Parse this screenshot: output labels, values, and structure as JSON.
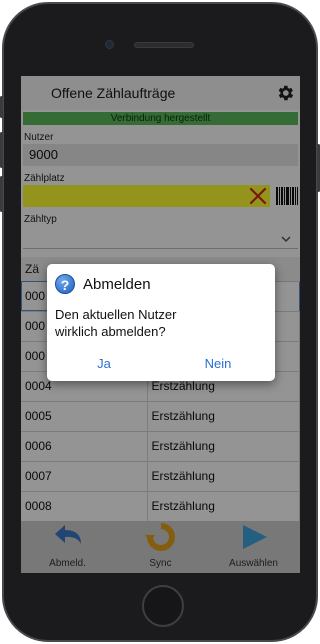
{
  "header": {
    "title": "Offene Zählaufträge",
    "settings_icon": "gear-icon"
  },
  "status": {
    "connection": "Verbindung hergestellt",
    "color": "#5cb85c"
  },
  "form": {
    "user_label": "Nutzer",
    "user_value": "9000",
    "zaehlplatz_label": "Zählplatz",
    "zaehlplatz_value": "",
    "zaehltyp_label": "Zähltyp",
    "zaehltyp_value": ""
  },
  "table": {
    "headers": [
      "Zä",
      ""
    ],
    "rows": [
      {
        "id": "000",
        "type": ""
      },
      {
        "id": "000",
        "type": ""
      },
      {
        "id": "000",
        "type": ""
      },
      {
        "id": "0004",
        "type": "Erstzählung"
      },
      {
        "id": "0005",
        "type": "Erstzählung"
      },
      {
        "id": "0006",
        "type": "Erstzählung"
      },
      {
        "id": "0007",
        "type": "Erstzählung"
      },
      {
        "id": "0008",
        "type": "Erstzählung"
      }
    ]
  },
  "toolbar": {
    "logout_label": "Abmeld.",
    "sync_label": "Sync",
    "select_label": "Auswählen"
  },
  "dialog": {
    "title": "Abmelden",
    "message": "Den aktuellen Nutzer wirklich abmelden?",
    "yes_label": "Ja",
    "no_label": "Nein",
    "icon": "question-icon"
  },
  "colors": {
    "accent": "#2a6fd6",
    "highlight_yellow": "#ffff33",
    "clear_red": "#cc2a1a"
  }
}
